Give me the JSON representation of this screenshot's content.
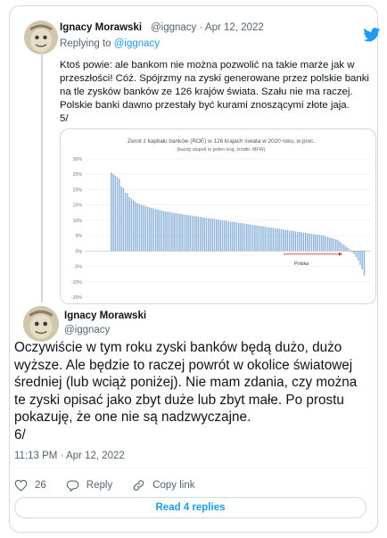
{
  "reply_tweet": {
    "name": "Ignacy Morawski",
    "handle": "@iggnacy",
    "date": "Apr 12, 2022",
    "replying_to_label": "Replying to",
    "replying_to_handle": "@iggnacy",
    "text_lines": [
      "Ktoś powie: ale bankom nie można pozwolić na takie marże jak w",
      "przeszłości! Cóż. Spójrzmy na zyski generowane przez polskie banki",
      "na tle zysków banków ze 126 krajów świata. Szału nie ma raczej.",
      "Polskie banki dawno przestały być kurami znoszącymi złote jaja.",
      "5/"
    ]
  },
  "chart_data": {
    "type": "bar",
    "title": "Zwrot z kapitału banków (ROE) w 126 krajach świata w 2020 roku, w proc.",
    "subtitle": "(każdy słupek to jeden kraj, źródło: MFW)",
    "ylim": [
      -15,
      30
    ],
    "yticks": [
      "30%",
      "25%",
      "20%",
      "15%",
      "10%",
      "5%",
      "0%",
      "-5%",
      "-10%",
      "-15%"
    ],
    "bar_color": "#8fb4d9",
    "highlight_color": "#d93030",
    "highlight_label": "Polska",
    "highlight_value": -1,
    "values": [
      25.5,
      25,
      24.5,
      24,
      23.5,
      21,
      20.5,
      19,
      18.8,
      17.5,
      17,
      16.5,
      16,
      15.5,
      15.2,
      15,
      14.8,
      14.6,
      14.4,
      14.2,
      14,
      13.8,
      13.6,
      13.5,
      13.3,
      13.2,
      13,
      12.9,
      12.8,
      12.7,
      12.5,
      12.4,
      12.3,
      12.2,
      12.1,
      12,
      11.9,
      11.8,
      11.7,
      11.6,
      11.5,
      11.4,
      11.3,
      11.2,
      11.1,
      11,
      10.9,
      10.8,
      10.7,
      10.6,
      10.5,
      10.4,
      10.3,
      10.2,
      10.1,
      10,
      9.9,
      9.8,
      9.7,
      9.6,
      9.5,
      9.4,
      9.3,
      9.2,
      9.1,
      9,
      8.9,
      8.8,
      8.7,
      8.6,
      8.5,
      8.4,
      8.3,
      8.2,
      8.1,
      8,
      7.9,
      7.8,
      7.7,
      7.6,
      7.5,
      7.4,
      7.3,
      7.2,
      7.1,
      7,
      6.9,
      6.8,
      6.7,
      6.6,
      6.5,
      6.4,
      6.3,
      6.2,
      6.1,
      6,
      5.9,
      5.8,
      5.7,
      5.6,
      5.5,
      5.4,
      5.3,
      5.2,
      5.1,
      5,
      4.8,
      4.6,
      4.4,
      4.2,
      4,
      3.8,
      3.5,
      3,
      2.5,
      2,
      1.5,
      1,
      0.5,
      -0.5,
      -1,
      -2,
      -3,
      -4.5,
      -6,
      -8
    ]
  },
  "main_tweet": {
    "name": "Ignacy Morawski",
    "handle": "@iggnacy",
    "text_lines": [
      "Oczywiście w tym roku zyski banków będą dużo, dużo",
      "wyższe. Ale będzie to raczej powrót w okolice światowej",
      "średniej (lub wciąż poniżej). Nie mam zdania, czy można",
      "te zyski opisać jako zbyt duże lub zbyt małe. Po prostu",
      "pokazuję, że one nie są nadzwyczajne.",
      "6/"
    ],
    "timestamp": "11:13 PM · Apr 12, 2022",
    "like_count": "26",
    "reply_label": "Reply",
    "copy_link_label": "Copy link",
    "read_replies_label": "Read 4 replies"
  },
  "colors": {
    "accent": "#1d9bf0",
    "like": "#536471",
    "border": "#cfd9de"
  },
  "icons": [
    "twitter-bird-icon",
    "heart-icon",
    "reply-icon",
    "link-icon"
  ]
}
